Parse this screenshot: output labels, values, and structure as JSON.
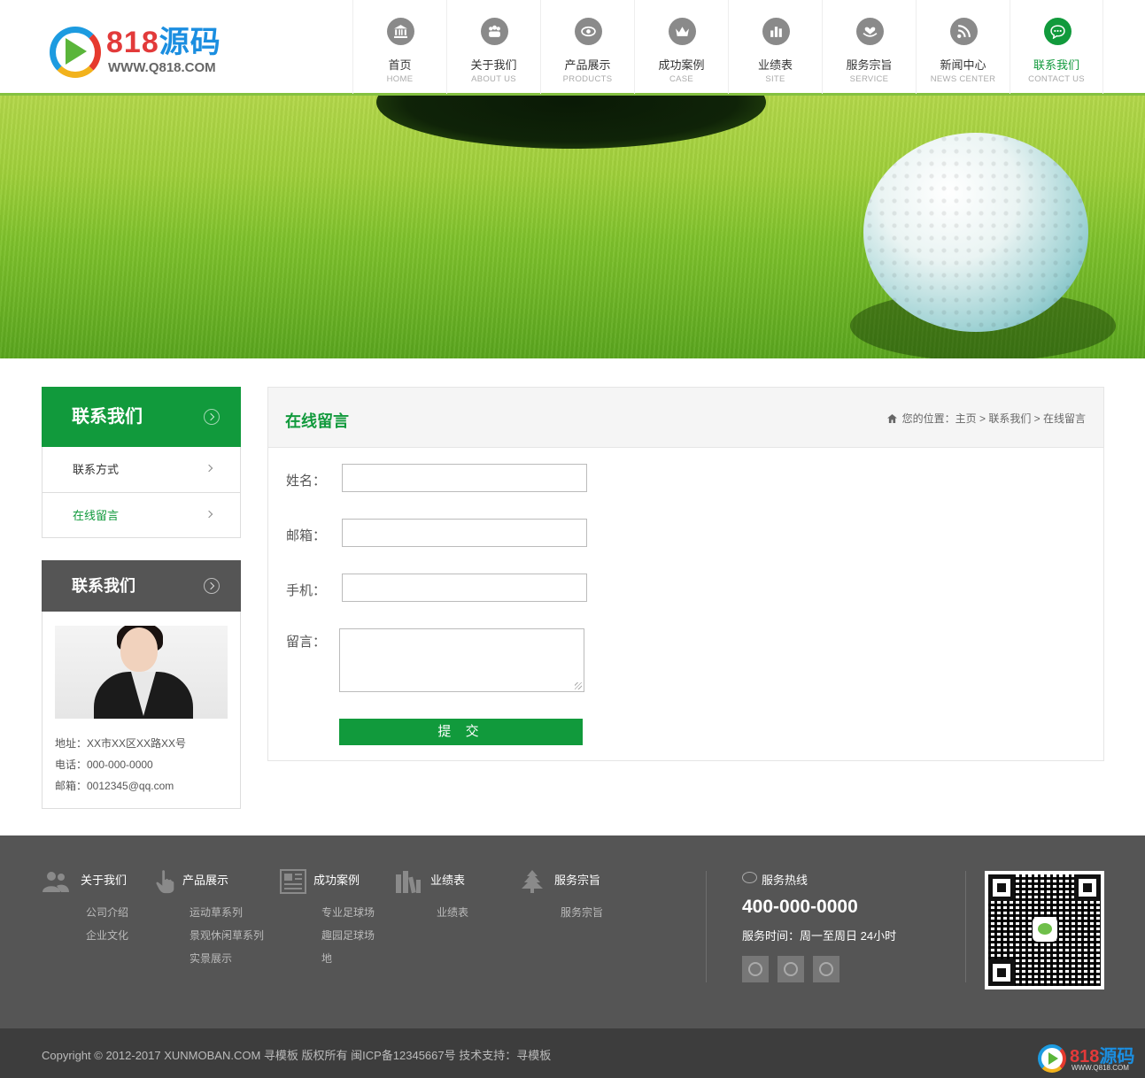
{
  "logo": {
    "brand_num": "818",
    "brand_cn": "源码",
    "url": "WWW.Q818.COM"
  },
  "nav": [
    {
      "cn": "首页",
      "en": "HOME",
      "icon": "bank-icon"
    },
    {
      "cn": "关于我们",
      "en": "ABOUT US",
      "icon": "team-icon"
    },
    {
      "cn": "产品展示",
      "en": "PRODUCTS",
      "icon": "eye-icon"
    },
    {
      "cn": "成功案例",
      "en": "CASE",
      "icon": "crown-icon"
    },
    {
      "cn": "业绩表",
      "en": "SITE",
      "icon": "chart-icon"
    },
    {
      "cn": "服务宗旨",
      "en": "SERVICE",
      "icon": "heart-hands-icon"
    },
    {
      "cn": "新闻中心",
      "en": "NEWS CENTER",
      "icon": "rss-icon"
    },
    {
      "cn": "联系我们",
      "en": "CONTACT US",
      "icon": "chat-icon",
      "active": true
    }
  ],
  "sidebar": {
    "title": "联系我们",
    "items": [
      {
        "label": "联系方式",
        "active": false
      },
      {
        "label": "在线留言",
        "active": true
      }
    ]
  },
  "contact": {
    "title": "联系我们",
    "address": "地址：XX市XX区XX路XX号",
    "phone": "电话：000-000-0000",
    "email": "邮箱：0012345@qq.com"
  },
  "main": {
    "title": "在线留言",
    "breadcrumb": "您的位置：主页 > 联系我们 > 在线留言",
    "form": {
      "name_label": "姓名：",
      "email_label": "邮箱：",
      "mobile_label": "手机：",
      "message_label": "留言：",
      "name_value": "",
      "email_value": "",
      "mobile_value": "",
      "message_value": "",
      "submit": "提 交"
    }
  },
  "footer": {
    "columns": [
      {
        "title": "关于我们",
        "icon": "people-icon",
        "links": [
          "公司介绍",
          "企业文化"
        ]
      },
      {
        "title": "产品展示",
        "icon": "hand-pointer-icon",
        "links": [
          "运动草系列",
          "景观休闲草系列",
          "实景展示"
        ]
      },
      {
        "title": "成功案例",
        "icon": "newspaper-icon",
        "links": [
          "专业足球场",
          "趣园足球场",
          "地"
        ]
      },
      {
        "title": "业绩表",
        "icon": "books-icon",
        "links": [
          "业绩表"
        ]
      },
      {
        "title": "服务宗旨",
        "icon": "tree-icon",
        "links": [
          "服务宗旨"
        ]
      }
    ],
    "hotline_label": "服务热线",
    "hotline_number": "400-000-0000",
    "service_time": "服务时间：周一至周日 24小时",
    "socials": [
      "wechat-icon",
      "weibo-icon",
      "tencent-weibo-icon"
    ],
    "copyright": "Copyright © 2012-2017 XUNMOBAN.COM 寻模板 版权所有 闽ICP备12345667号 技术支持：寻模板"
  },
  "watermark": {
    "brand_num": "818",
    "brand_cn": "源码",
    "url": "WWW.Q818.COM"
  },
  "colors": {
    "accent": "#119a3c",
    "nav_underline": "#84c140",
    "footer_bg": "#555555",
    "bottom_bg": "#3d3d3d"
  }
}
